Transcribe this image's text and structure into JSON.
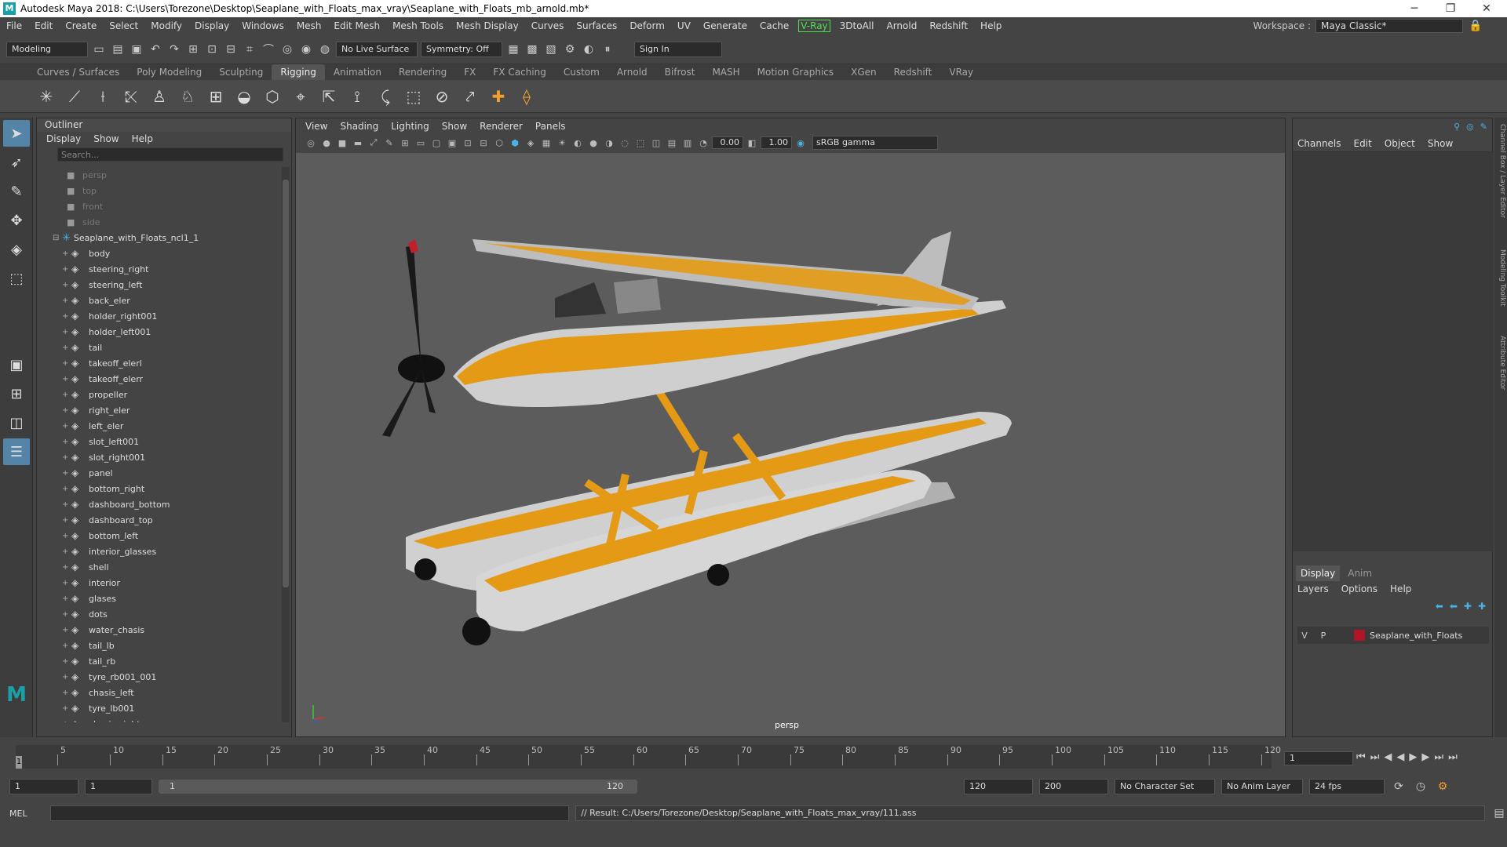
{
  "window": {
    "title": "Autodesk Maya 2018: C:\\Users\\Torezone\\Desktop\\Seaplane_with_Floats_max_vray\\Seaplane_with_Floats_mb_arnold.mb*",
    "minimize": "─",
    "restore": "❐",
    "close": "✕"
  },
  "menubar": {
    "items": [
      "File",
      "Edit",
      "Create",
      "Select",
      "Modify",
      "Display",
      "Windows",
      "Mesh",
      "Edit Mesh",
      "Mesh Tools",
      "Mesh Display",
      "Curves",
      "Surfaces",
      "Deform",
      "UV",
      "Generate",
      "Cache"
    ],
    "vray": "V-Ray",
    "items2": [
      "3DtoAll",
      "Arnold",
      "Redshift",
      "Help"
    ],
    "workspace_label": "Workspace :",
    "workspace_value": "Maya Classic*"
  },
  "statusline": {
    "mode": "Modeling",
    "live_surface": "No Live Surface",
    "symmetry": "Symmetry: Off",
    "sign_in": "Sign In"
  },
  "shelf_tabs": [
    "Curves / Surfaces",
    "Poly Modeling",
    "Sculpting",
    "Rigging",
    "Animation",
    "Rendering",
    "FX",
    "FX Caching",
    "Custom",
    "Arnold",
    "Bifrost",
    "MASH",
    "Motion Graphics",
    "XGen",
    "Redshift",
    "VRay"
  ],
  "active_shelf_tab": "Rigging",
  "outliner": {
    "title": "Outliner",
    "menu": [
      "Display",
      "Show",
      "Help"
    ],
    "search_placeholder": "Search...",
    "cameras": [
      "persp",
      "top",
      "front",
      "side"
    ],
    "root": "Seaplane_with_Floats_ncl1_1",
    "children": [
      "body",
      "steering_right",
      "steering_left",
      "back_eler",
      "holder_right001",
      "holder_left001",
      "tail",
      "takeoff_elerl",
      "takeoff_elerr",
      "propeller",
      "right_eler",
      "left_eler",
      "slot_left001",
      "slot_right001",
      "panel",
      "bottom_right",
      "dashboard_bottom",
      "dashboard_top",
      "bottom_left",
      "interior_glasses",
      "shell",
      "interior",
      "glases",
      "dots",
      "water_chasis",
      "tail_lb",
      "tail_rb",
      "tyre_rb001_001",
      "chasis_left",
      "tyre_lb001",
      "chasis_right"
    ]
  },
  "viewport": {
    "menu": [
      "View",
      "Shading",
      "Lighting",
      "Show",
      "Renderer",
      "Panels"
    ],
    "exposure": "0.00",
    "gamma": "1.00",
    "colorspace": "sRGB gamma",
    "camera_label": "persp"
  },
  "channelbox": {
    "menu": [
      "Channels",
      "Edit",
      "Object",
      "Show"
    ],
    "side_labels": [
      "Channel Box / Layer Editor",
      "Modeling Toolkit",
      "Attribute Editor"
    ]
  },
  "layers": {
    "tabs": [
      "Display",
      "Anim"
    ],
    "menu": [
      "Layers",
      "Options",
      "Help"
    ],
    "row": {
      "v": "V",
      "p": "P",
      "name": "Seaplane_with_Floats",
      "color": "#b01426"
    }
  },
  "timeline": {
    "ticks": [
      "5",
      "10",
      "15",
      "20",
      "25",
      "30",
      "35",
      "40",
      "45",
      "50",
      "55",
      "60",
      "65",
      "70",
      "75",
      "80",
      "85",
      "90",
      "95",
      "100",
      "105",
      "110",
      "115",
      "120"
    ],
    "current": "1",
    "current_frame_field": "1"
  },
  "range": {
    "start": "1",
    "start2": "1",
    "slider_start": "1",
    "slider_end": "120",
    "end": "120",
    "end2": "200",
    "character_set": "No Character Set",
    "anim_layer": "No Anim Layer",
    "fps": "24 fps"
  },
  "cmdline": {
    "lang": "MEL",
    "result": "// Result: C:/Users/Torezone/Desktop/Seaplane_with_Floats_max_vray/111.ass"
  }
}
